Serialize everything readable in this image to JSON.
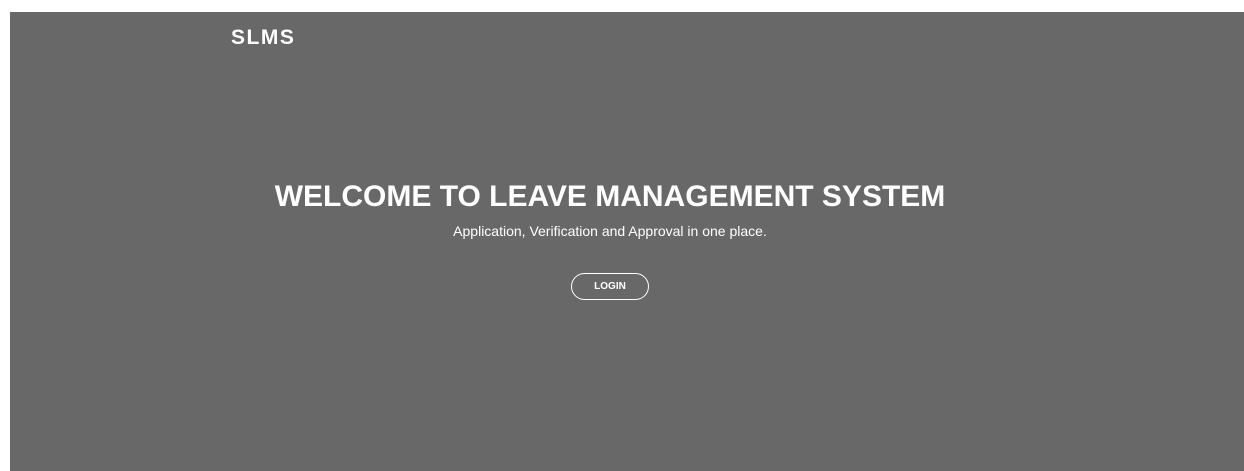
{
  "brand": {
    "name": "SLMS"
  },
  "hero": {
    "title": "WELCOME TO LEAVE MANAGEMENT SYSTEM",
    "subtitle": "Application, Verification and Approval in one place.",
    "login_label": "LOGIN"
  },
  "colors": {
    "background": "#686868",
    "text": "#ffffff"
  }
}
